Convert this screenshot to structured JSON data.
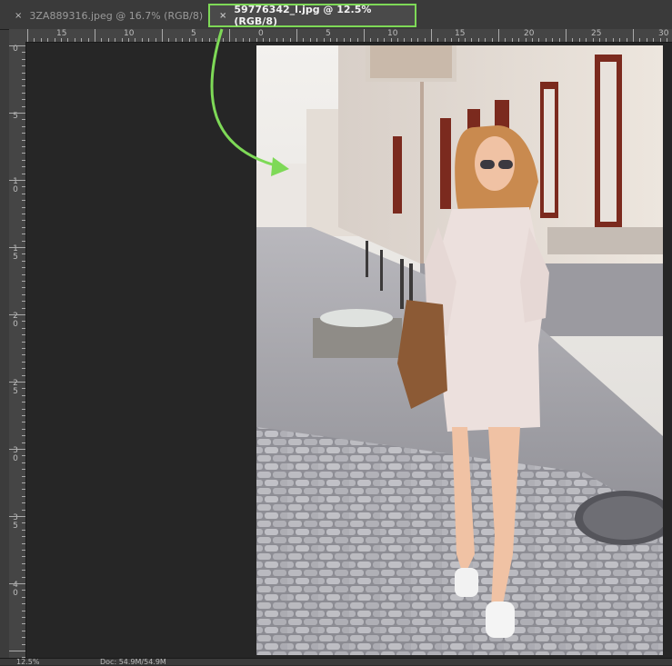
{
  "tabs": [
    {
      "close": "×",
      "label": "3ZA889316.jpeg @ 16.7% (RGB/8)",
      "active": false
    },
    {
      "close": "×",
      "label": "59776342_l.jpg @ 12.5% (RGB/8)",
      "active": true
    }
  ],
  "ruler_h": [
    "15",
    "10",
    "5",
    "0",
    "5",
    "10",
    "15",
    "20",
    "25",
    "30"
  ],
  "ruler_v": [
    "0",
    "5",
    "1 0",
    "1 5",
    "2 0",
    "2 5",
    "3 0",
    "3 5",
    "4 0"
  ],
  "status": {
    "zoom": "12.5%",
    "doc": "Doc: 54.9M/54.9M"
  },
  "photo_description_icon": "image-photo",
  "colors": {
    "highlight": "#7ed957",
    "canvas": "#262626"
  }
}
